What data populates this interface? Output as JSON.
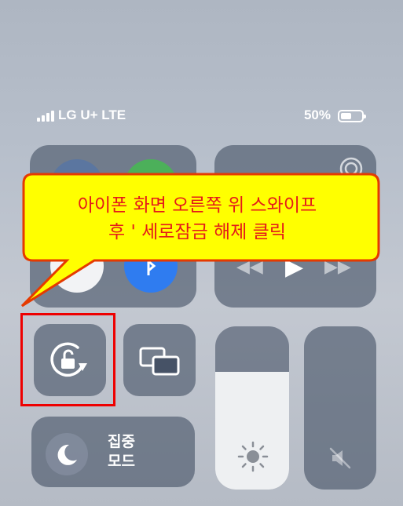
{
  "status_bar": {
    "carrier": "LG U+ LTE",
    "battery_percent_text": "50%",
    "battery_level": 0.5
  },
  "focus": {
    "line1": "집중",
    "line2": "모드"
  },
  "brightness_level": 0.72,
  "annotation": {
    "line1": "아이폰 화면 오른쪽 위 스와이프",
    "line2": "후 ' 세로잠금 해제 클릭"
  },
  "icons": {
    "rotation_lock": "rotation-lock-icon",
    "screen_mirroring": "screen-mirroring-icon",
    "moon": "moon-icon",
    "sun": "sun-icon",
    "mute": "speaker-mute-icon"
  },
  "colors": {
    "annotation_fill": "#ffff00",
    "annotation_text": "#e41a1a",
    "highlight": "#ee0000"
  }
}
